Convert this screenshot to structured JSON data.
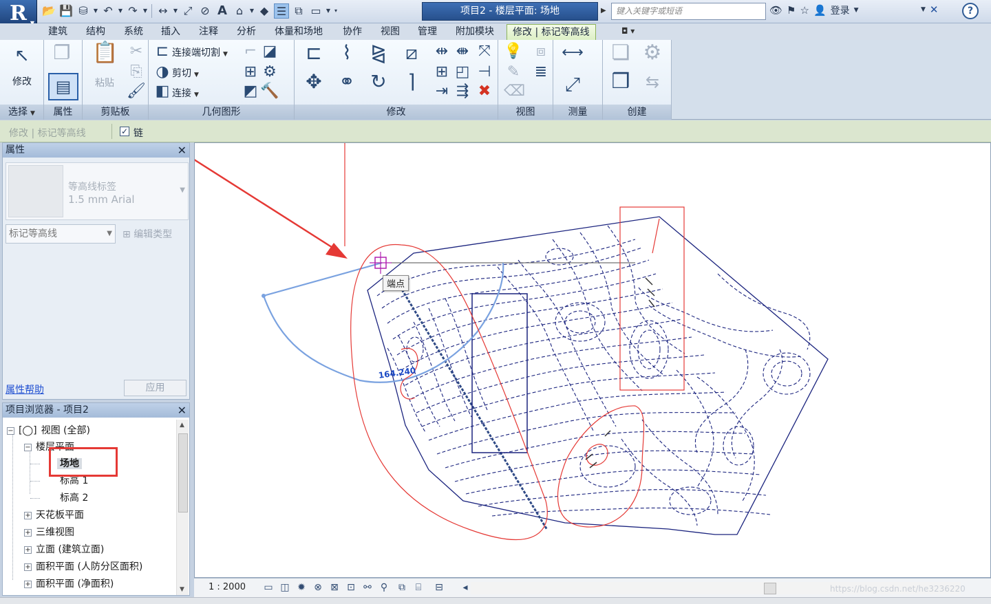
{
  "title_bar": {
    "app_menu_letter": "R",
    "document_title": "项目2 - 楼层平面: 场地",
    "search_placeholder": "键入关键字或短语",
    "login_label": "登录",
    "help_label": "?"
  },
  "ribbon_tabs": [
    {
      "label": "建筑"
    },
    {
      "label": "结构"
    },
    {
      "label": "系统"
    },
    {
      "label": "插入"
    },
    {
      "label": "注释"
    },
    {
      "label": "分析"
    },
    {
      "label": "体量和场地"
    },
    {
      "label": "协作"
    },
    {
      "label": "视图"
    },
    {
      "label": "管理"
    },
    {
      "label": "附加模块"
    },
    {
      "label": "修改 | 标记等高线",
      "active": true
    }
  ],
  "ribbon_panels": {
    "select": {
      "label": "选择",
      "modify_button": "修改"
    },
    "properties": {
      "label": "属性"
    },
    "clipboard": {
      "label": "剪贴板",
      "paste_button": "粘贴"
    },
    "geometry": {
      "label": "几何图形",
      "join_cut": "连接端切割",
      "cut": "剪切",
      "join": "连接"
    },
    "modify": {
      "label": "修改"
    },
    "view": {
      "label": "视图"
    },
    "measure": {
      "label": "测量"
    },
    "create": {
      "label": "创建"
    }
  },
  "options_bar": {
    "context_label": "修改 | 标记等高线",
    "chain_label": "链",
    "chain_checked": true
  },
  "properties_palette": {
    "header": "属性",
    "type_name": "等高线标签",
    "type_size": "1.5 mm Arial",
    "instance_selector": "标记等高线",
    "edit_type": "编辑类型",
    "help_link": "属性帮助",
    "apply_button": "应用"
  },
  "project_browser": {
    "header": "项目浏览器 - 项目2",
    "items": [
      {
        "label": "视图 (全部)",
        "level": 0,
        "expanded": true
      },
      {
        "label": "楼层平面",
        "level": 1,
        "expanded": true
      },
      {
        "label": "场地",
        "level": 2,
        "selected": true
      },
      {
        "label": "标高 1",
        "level": 2
      },
      {
        "label": "标高 2",
        "level": 2
      },
      {
        "label": "天花板平面",
        "level": 1,
        "expanded": false
      },
      {
        "label": "三维视图",
        "level": 1,
        "expanded": false
      },
      {
        "label": "立面 (建筑立面)",
        "level": 1,
        "expanded": false
      },
      {
        "label": "面积平面 (人防分区面积)",
        "level": 1,
        "expanded": false
      },
      {
        "label": "面积平面 (净面积)",
        "level": 1,
        "expanded": false
      }
    ]
  },
  "canvas": {
    "snap_tooltip": "端点",
    "dimension_text": "164.240",
    "annotation_color": "#e53935",
    "contour_color": "#1a237e",
    "sketch_color": "#7aa2e0"
  },
  "view_control_bar": {
    "scale": "1 : 2000",
    "watermark": "https://blog.csdn.net/he3236220"
  }
}
